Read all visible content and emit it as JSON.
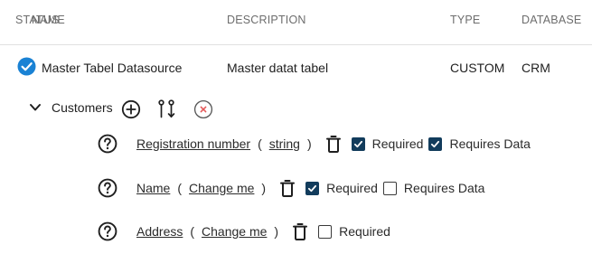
{
  "table": {
    "headers": {
      "status": "STATUS",
      "name": "NAME",
      "description": "DESCRIPTION",
      "type": "TYPE",
      "database": "DATABASE"
    },
    "row": {
      "name": "Master Tabel Datasource",
      "description": "Master datat tabel",
      "type": "CUSTOM",
      "database": "CRM",
      "status_color": "#1a82d4"
    }
  },
  "group": {
    "label": "Customers"
  },
  "fields": [
    {
      "name": "Registration number",
      "open_paren": "(",
      "type": "string",
      "close_paren": ")",
      "required": {
        "label": "Required",
        "checked": true
      },
      "requires_data": {
        "label": "Requires Data",
        "checked": true
      }
    },
    {
      "name": "Name",
      "open_paren": "(",
      "type": "Change me",
      "close_paren": ")",
      "required": {
        "label": "Required",
        "checked": true
      },
      "requires_data": {
        "label": "Requires Data",
        "checked": false
      }
    },
    {
      "name": "Address",
      "open_paren": "(",
      "type": "Change me",
      "close_paren": ")",
      "required": {
        "label": "Required",
        "checked": false
      }
    }
  ],
  "colors": {
    "checkbox_checked": "#123c5c",
    "remove_icon": "#e45a5a",
    "header_text": "#6d6d6d"
  }
}
